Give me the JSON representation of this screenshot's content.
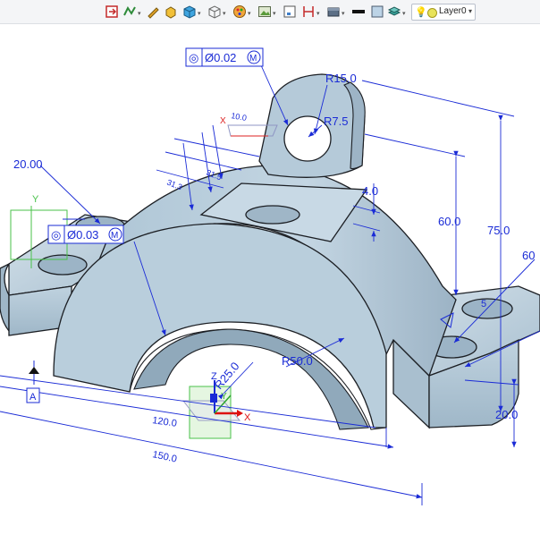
{
  "toolbar": {
    "icons": [
      "exit-icon",
      "sketch-icon",
      "pencil-icon",
      "solid-icon",
      "box-icon",
      "wireframe-icon",
      "appearance-icon",
      "image-icon",
      "frame-icon",
      "height-dim-icon",
      "material-icon",
      "line-weight-icon",
      "color-swatch-icon",
      "layer-visibility-icon"
    ],
    "layer": {
      "bulb": "💡",
      "label": "Layer0",
      "arrow": "▾"
    }
  },
  "viewport": {
    "dimensions": {
      "r15": "R15.0",
      "r7_5": "R7.5",
      "d75": "75.0",
      "d60": "60.0",
      "d4": "4.0",
      "r50": "R50.0",
      "r25": "R25.0",
      "d120": "120.0",
      "d150": "150.0",
      "d20_left": "20.00",
      "d60_right": "60",
      "d20_right": "20.0",
      "d10": "10.0",
      "d31_5": "31.5",
      "d31_3": "31.3",
      "d5": "5"
    },
    "gdt": {
      "top_symbol": "◎",
      "top_value": "Ø0.02",
      "top_modifier": "M",
      "left_symbol": "◎",
      "left_value": "Ø0.03",
      "left_modifier": "M"
    },
    "datum": "A",
    "axes": {
      "x": "X",
      "y": "Y",
      "z": "Z",
      "x_ref": "X",
      "y_ref": "Y"
    },
    "colors": {
      "part": "#b6cad8",
      "edge": "#1c1f24",
      "dimension": "#1a2bd6",
      "datum_plane": "#49c24a"
    }
  }
}
